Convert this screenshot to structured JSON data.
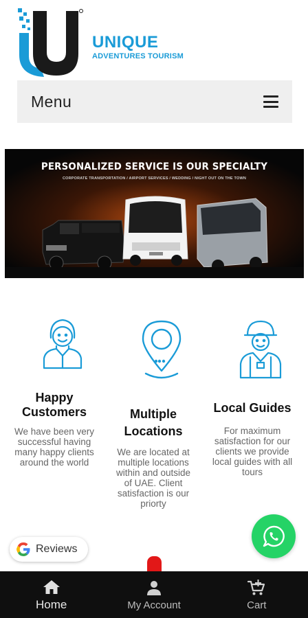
{
  "brand": {
    "name": "UNIQUE",
    "tagline": "ADVENTURES TOURISM",
    "color": "#1a9bd7"
  },
  "menu": {
    "label": "Menu",
    "icon": "hamburger-icon"
  },
  "banner": {
    "title": "PERSONALIZED SERVICE IS OUR SPECIALTY",
    "subtitle": "CORPORATE TRANSPORTATION / AIRPORT SERVICES / WEDDING / NIGHT OUT ON THE TOWN"
  },
  "features": [
    {
      "icon": "happy-customer-icon",
      "title_line1": "Happy",
      "title_line2": "Customers",
      "desc": [
        "We have been very",
        "successful having",
        "many happy clients",
        "around the world"
      ]
    },
    {
      "icon": "location-pin-icon",
      "title_line1": "Multiple",
      "title_line2": "Locations",
      "desc": [
        "We are located at",
        "multiple locations",
        "within and outside",
        "of UAE. Client",
        "satisfaction is our",
        "priorty"
      ]
    },
    {
      "icon": "tour-guide-icon",
      "title_line1": "Local Guides",
      "desc": [
        "For maximum",
        "satisfaction for our",
        "clients we provide",
        "local guides with all",
        "tours"
      ]
    }
  ],
  "reviews": {
    "label": "Reviews",
    "icon": "google-icon"
  },
  "whatsapp": {
    "icon": "whatsapp-icon",
    "color": "#25d366"
  },
  "bottom_nav": {
    "items": [
      {
        "label": "Home",
        "icon": "home-icon",
        "active": true
      },
      {
        "label": "My Account",
        "icon": "account-icon",
        "active": false
      },
      {
        "label": "Cart",
        "icon": "cart-icon",
        "active": false
      }
    ],
    "accent": "#e21818"
  }
}
